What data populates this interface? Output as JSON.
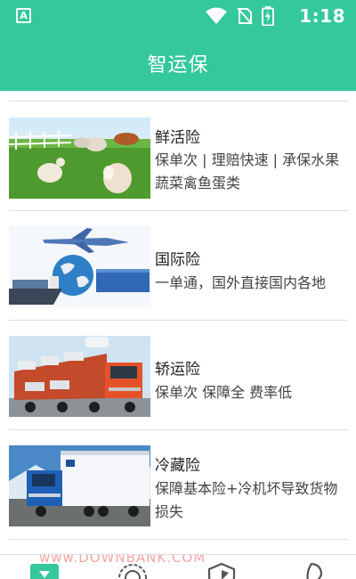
{
  "status_bar": {
    "badge_label": "A",
    "time": "1:18",
    "icons": [
      "wifi-icon",
      "no-sim-icon",
      "battery-charging-icon"
    ]
  },
  "app_bar": {
    "title": "智运保"
  },
  "insurance_list": [
    {
      "title": "鲜活险",
      "description": "保单次 | 理赔快速 | 承保水果蔬菜禽鱼蛋类",
      "image": "livestock-farm-image"
    },
    {
      "title": "国际险",
      "description": "一单通，国外直接国内各地",
      "image": "global-logistics-image"
    },
    {
      "title": "轿运险",
      "description": "保单次 保障全 费率低",
      "image": "car-carrier-truck-image"
    },
    {
      "title": "冷藏险",
      "description": "保障基本险+冷机坏导致货物损失",
      "image": "refrigerated-truck-image"
    }
  ],
  "bottom_nav": {
    "tabs": [
      "home-tab-icon",
      "policy-tab-icon",
      "shield-tab-icon",
      "profile-tab-icon"
    ],
    "active_color": "#34c89a"
  },
  "colors": {
    "primary": "#34c89a",
    "divider": "#dedede"
  },
  "watermark": "www.DOWNBANK.COM"
}
